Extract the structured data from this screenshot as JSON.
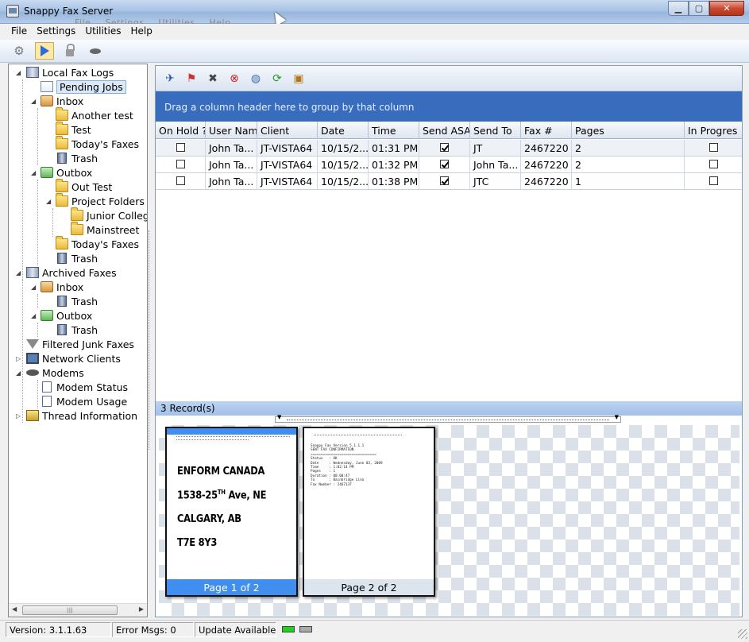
{
  "window": {
    "title": "Snappy Fax Server",
    "ghost_menu": [
      "File",
      "Settings",
      "Utilities",
      "Help"
    ],
    "controls": {
      "minimize": "▁",
      "maximize": "▢",
      "close": "✕"
    }
  },
  "menu": [
    "File",
    "Settings",
    "Utilities",
    "Help"
  ],
  "toolbar": {
    "icons": [
      "gear-icon",
      "play-icon",
      "lock-icon",
      "modem-icon"
    ]
  },
  "tree": {
    "local_fax_logs": "Local Fax Logs",
    "pending_jobs": "Pending Jobs",
    "inbox": "Inbox",
    "another_test": "Another test",
    "test": "Test",
    "todays_faxes": "Today's Faxes",
    "trash": "Trash",
    "outbox": "Outbox",
    "out_test": "Out Test",
    "project_folders": "Project Folders",
    "junior_college": "Junior Colleg",
    "mainstreet": "Mainstreet",
    "archived_faxes": "Archived Faxes",
    "filtered_junk": "Filtered Junk Faxes",
    "network_clients": "Network Clients",
    "modems": "Modems",
    "modem_status": "Modem  Status",
    "modem_usage": "Modem  Usage",
    "thread_info": "Thread Information"
  },
  "grid": {
    "group_hint": "Drag a column header here to group by that column",
    "columns": [
      "On Hold ?",
      "User Name",
      "Client",
      "Date",
      "Time",
      "Send ASA",
      "Send To",
      "Fax #",
      "Pages",
      "In Progres"
    ],
    "rows": [
      {
        "on_hold": false,
        "user": "John Ta...",
        "client": "JT-VISTA64",
        "date": "10/15/2...",
        "time": "01:31 PM",
        "send_asap": true,
        "send_to": "JT",
        "fax": "2467220",
        "pages": "2",
        "in_progress": false
      },
      {
        "on_hold": false,
        "user": "John Ta...",
        "client": "JT-VISTA64",
        "date": "10/15/2...",
        "time": "01:32 PM",
        "send_asap": true,
        "send_to": "John Ta...",
        "fax": "2467220",
        "pages": "2",
        "in_progress": false
      },
      {
        "on_hold": false,
        "user": "John Ta...",
        "client": "JT-VISTA64",
        "date": "10/15/2...",
        "time": "01:38 PM",
        "send_asap": true,
        "send_to": "JTC",
        "fax": "2467220",
        "pages": "1",
        "in_progress": false
      }
    ],
    "record_count": "3 Record(s)"
  },
  "preview": {
    "page1": {
      "label": "Page 1 of 2",
      "line1": "ENFORM CANADA",
      "line2_a": "1538-25",
      "line2_sup": "TH",
      "line2_b": " Ave, NE",
      "line3": "CALGARY, AB",
      "line4": "T7E 8Y3"
    },
    "page2": {
      "label": "Page 2 of 2",
      "text": "Snappy Fax Version 5.1.1.1\nSENT FAX CONFIRMATION\n================================\nStatus   : OK\nDate     : Wednesday, June 03, 2009\nTime     : 1:02:14 PM\nPages    : 1\nDuration : 00:00:47\nTo       : Bainbridge Lina\nFax Number : 2467137"
    }
  },
  "status": {
    "version": "Version: 3.1.1.63",
    "errors": "Error Msgs: 0",
    "update": "Update Available"
  }
}
